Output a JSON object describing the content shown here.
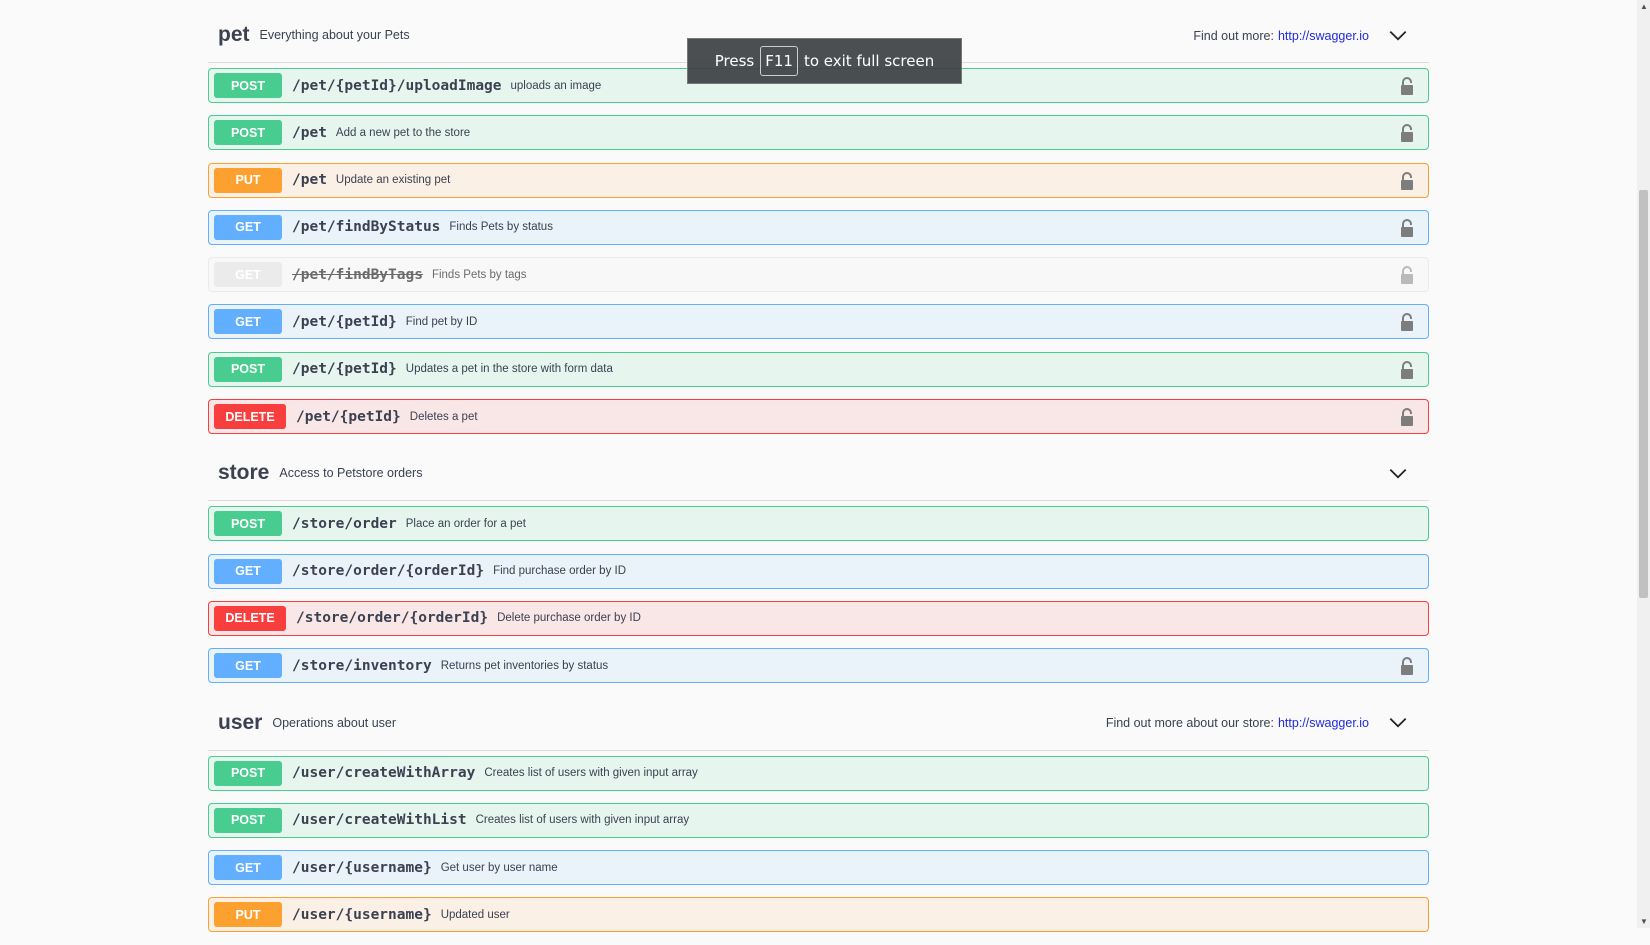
{
  "sections": [
    {
      "title": "pet",
      "desc": "Everything about your Pets",
      "find_more": "Find out more:",
      "link": "http://swagger.io",
      "ops": [
        {
          "method": "POST",
          "path": "/pet/{petId}/uploadImage",
          "desc": "uploads an image",
          "cls": "post",
          "lock": true
        },
        {
          "method": "POST",
          "path": "/pet",
          "desc": "Add a new pet to the store",
          "cls": "post",
          "lock": true
        },
        {
          "method": "PUT",
          "path": "/pet",
          "desc": "Update an existing pet",
          "cls": "put",
          "lock": true
        },
        {
          "method": "GET",
          "path": "/pet/findByStatus",
          "desc": "Finds Pets by status",
          "cls": "get",
          "lock": true
        },
        {
          "method": "GET",
          "path": "/pet/findByTags",
          "desc": "Finds Pets by tags",
          "cls": "dep",
          "lock": true
        },
        {
          "method": "GET",
          "path": "/pet/{petId}",
          "desc": "Find pet by ID",
          "cls": "get",
          "lock": true
        },
        {
          "method": "POST",
          "path": "/pet/{petId}",
          "desc": "Updates a pet in the store with form data",
          "cls": "post",
          "lock": true
        },
        {
          "method": "DELETE",
          "path": "/pet/{petId}",
          "desc": "Deletes a pet",
          "cls": "delete",
          "lock": true
        }
      ]
    },
    {
      "title": "store",
      "desc": "Access to Petstore orders",
      "find_more": null,
      "link": null,
      "ops": [
        {
          "method": "POST",
          "path": "/store/order",
          "desc": "Place an order for a pet",
          "cls": "post",
          "lock": false
        },
        {
          "method": "GET",
          "path": "/store/order/{orderId}",
          "desc": "Find purchase order by ID",
          "cls": "get",
          "lock": false
        },
        {
          "method": "DELETE",
          "path": "/store/order/{orderId}",
          "desc": "Delete purchase order by ID",
          "cls": "delete",
          "lock": false
        },
        {
          "method": "GET",
          "path": "/store/inventory",
          "desc": "Returns pet inventories by status",
          "cls": "get",
          "lock": true
        }
      ]
    },
    {
      "title": "user",
      "desc": "Operations about user",
      "find_more": "Find out more about our store:",
      "link": "http://swagger.io",
      "ops": [
        {
          "method": "POST",
          "path": "/user/createWithArray",
          "desc": "Creates list of users with given input array",
          "cls": "post",
          "lock": false
        },
        {
          "method": "POST",
          "path": "/user/createWithList",
          "desc": "Creates list of users with given input array",
          "cls": "post",
          "lock": false
        },
        {
          "method": "GET",
          "path": "/user/{username}",
          "desc": "Get user by user name",
          "cls": "get",
          "lock": false
        },
        {
          "method": "PUT",
          "path": "/user/{username}",
          "desc": "Updated user",
          "cls": "put",
          "lock": false
        }
      ]
    }
  ],
  "toast": {
    "press": "Press",
    "key": "F11",
    "rest": "to exit full screen"
  }
}
